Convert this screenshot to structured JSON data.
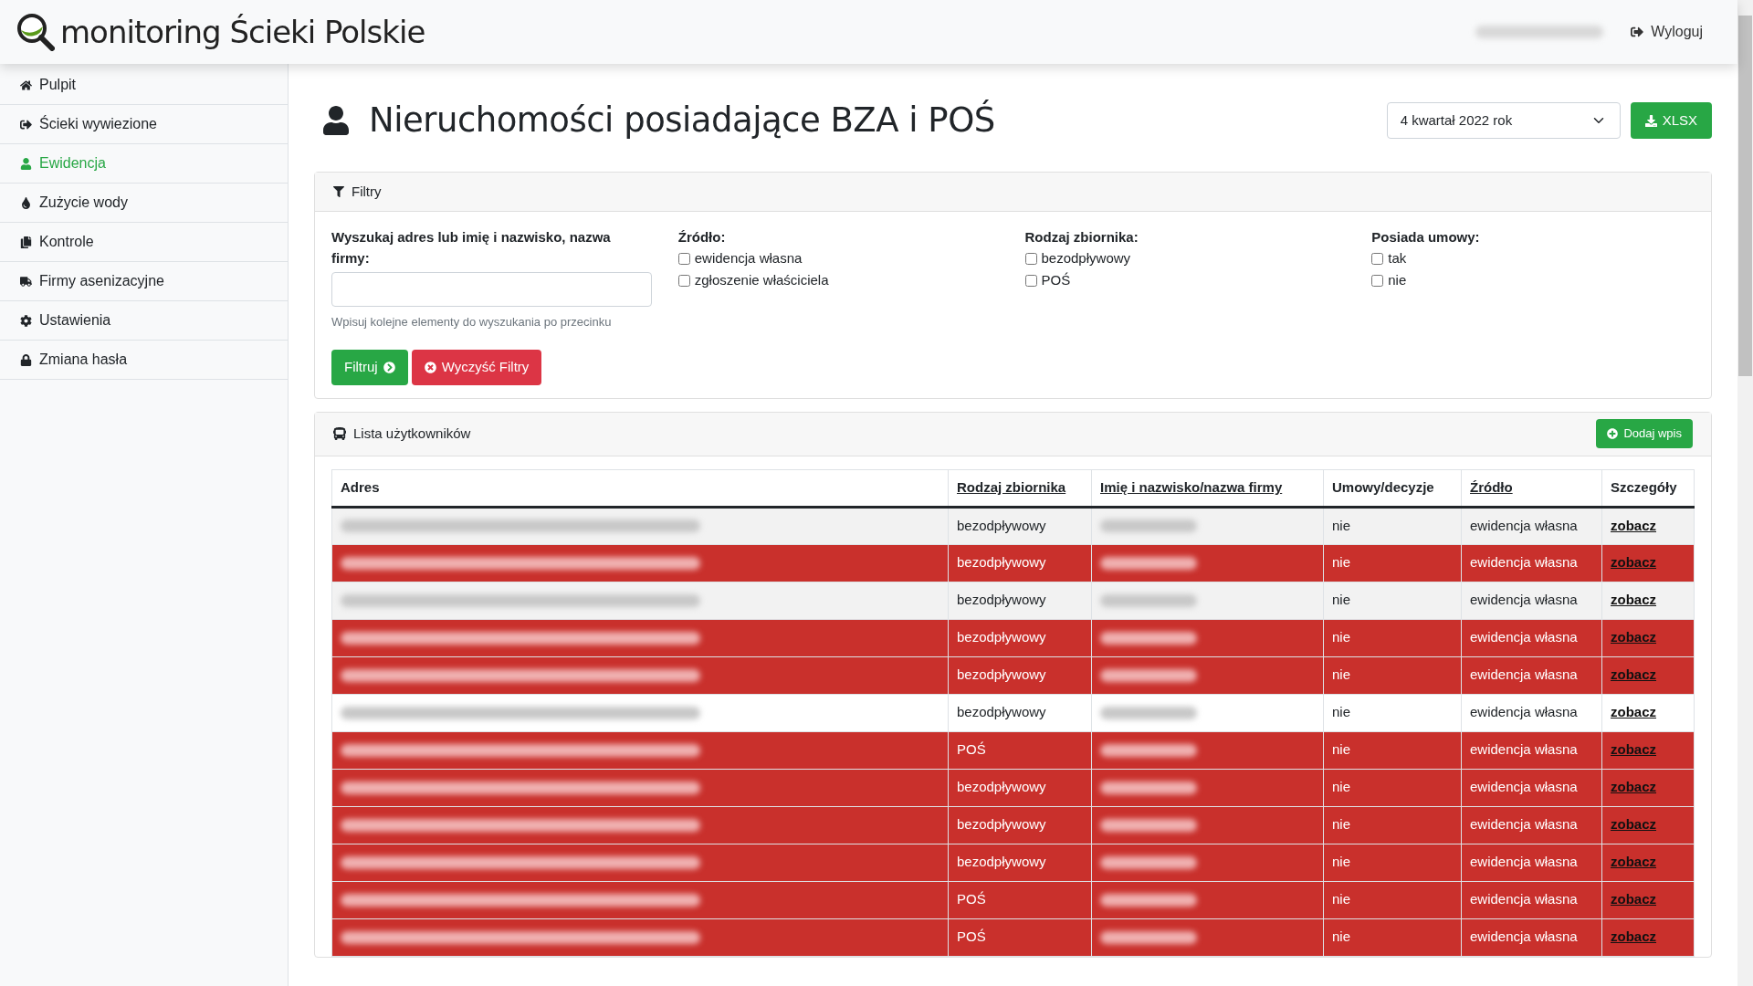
{
  "header": {
    "logo_text": "monitoring Ścieki Polskie",
    "user_redacted": true,
    "logout": "Wyloguj"
  },
  "sidebar": {
    "items": [
      {
        "label": "Pulpit",
        "selected": false
      },
      {
        "label": "Ścieki wywiezione",
        "selected": false
      },
      {
        "label": "Ewidencja",
        "selected": true
      },
      {
        "label": "Zużycie wody",
        "selected": false
      },
      {
        "label": "Kontrole",
        "selected": false
      },
      {
        "label": "Firmy asenizacyjne",
        "selected": false
      },
      {
        "label": "Ustawienia",
        "selected": false
      },
      {
        "label": "Zmiana hasła",
        "selected": false
      }
    ]
  },
  "page": {
    "title": "Nieruchomości posiadające BZA i POŚ",
    "period": "4 kwartał 2022 rok",
    "export_button": "XLSX"
  },
  "filters": {
    "title": "Filtry",
    "search_label": "Wyszukaj adres lub imię i nazwisko, nazwa firmy:",
    "search_hint": "Wpisuj kolejne elementy do wyszukania po przecinku",
    "groups": [
      {
        "label": "Źródło:",
        "options": [
          {
            "label": "ewidencja własna",
            "checked": false
          },
          {
            "label": "zgłoszenie właściciela",
            "checked": false
          }
        ]
      },
      {
        "label": "Rodzaj zbiornika:",
        "options": [
          {
            "label": "bezodpływowy",
            "checked": false
          },
          {
            "label": "POŚ",
            "checked": false
          }
        ]
      },
      {
        "label": "Posiada umowy:",
        "options": [
          {
            "label": "tak",
            "checked": false
          },
          {
            "label": "nie",
            "checked": false
          }
        ]
      }
    ],
    "apply_button": "Filtruj",
    "clear_button": "Wyczyść Filtry"
  },
  "list": {
    "title": "Lista użytkowników",
    "add_button": "Dodaj wpis",
    "columns": [
      {
        "label": "Adres",
        "sortable": false
      },
      {
        "label": "Rodzaj zbiornika",
        "sortable": true
      },
      {
        "label": "Imię i nazwisko/nazwa firmy",
        "sortable": true
      },
      {
        "label": "Umowy/decyzje",
        "sortable": false
      },
      {
        "label": "Źródło",
        "sortable": true
      },
      {
        "label": "Szczegóły",
        "sortable": false
      }
    ],
    "rows": [
      {
        "flagged": false,
        "address_redacted": true,
        "tank": "bezodpływowy",
        "name_redacted": true,
        "contracts": "nie",
        "source": "ewidencja własna",
        "details": "zobacz"
      },
      {
        "flagged": true,
        "address_redacted": true,
        "tank": "bezodpływowy",
        "name_redacted": true,
        "contracts": "nie",
        "source": "ewidencja własna",
        "details": "zobacz"
      },
      {
        "flagged": false,
        "address_redacted": true,
        "tank": "bezodpływowy",
        "name_redacted": true,
        "contracts": "nie",
        "source": "ewidencja własna",
        "details": "zobacz"
      },
      {
        "flagged": true,
        "address_redacted": true,
        "tank": "bezodpływowy",
        "name_redacted": true,
        "contracts": "nie",
        "source": "ewidencja własna",
        "details": "zobacz"
      },
      {
        "flagged": true,
        "address_redacted": true,
        "tank": "bezodpływowy",
        "name_redacted": true,
        "contracts": "nie",
        "source": "ewidencja własna",
        "details": "zobacz"
      },
      {
        "flagged": false,
        "address_redacted": true,
        "tank": "bezodpływowy",
        "name_redacted": true,
        "contracts": "nie",
        "source": "ewidencja własna",
        "details": "zobacz"
      },
      {
        "flagged": true,
        "address_redacted": true,
        "tank": "POŚ",
        "name_redacted": true,
        "contracts": "nie",
        "source": "ewidencja własna",
        "details": "zobacz"
      },
      {
        "flagged": true,
        "address_redacted": true,
        "tank": "bezodpływowy",
        "name_redacted": true,
        "contracts": "nie",
        "source": "ewidencja własna",
        "details": "zobacz"
      },
      {
        "flagged": true,
        "address_redacted": true,
        "tank": "bezodpływowy",
        "name_redacted": true,
        "contracts": "nie",
        "source": "ewidencja własna",
        "details": "zobacz"
      },
      {
        "flagged": true,
        "address_redacted": true,
        "tank": "bezodpływowy",
        "name_redacted": true,
        "contracts": "nie",
        "source": "ewidencja własna",
        "details": "zobacz"
      },
      {
        "flagged": true,
        "address_redacted": true,
        "tank": "POŚ",
        "name_redacted": true,
        "contracts": "nie",
        "source": "ewidencja własna",
        "details": "zobacz"
      },
      {
        "flagged": true,
        "address_redacted": true,
        "tank": "POŚ",
        "name_redacted": true,
        "contracts": "nie",
        "source": "ewidencja własna",
        "details": "zobacz"
      }
    ]
  }
}
